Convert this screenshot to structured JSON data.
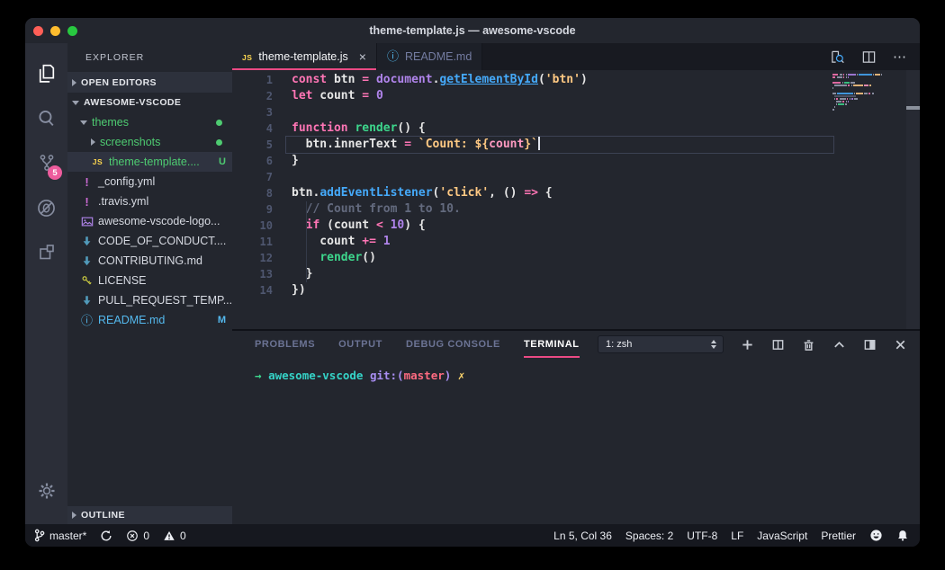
{
  "window": {
    "title": "theme-template.js — awesome-vscode"
  },
  "colors": {
    "traffic_red": "#ff5f57",
    "traffic_yellow": "#febc2e",
    "traffic_green": "#28c840",
    "editor_bg": "#23262e",
    "activitybar_bg": "#2b2e38",
    "tabstrip_bg": "#181a21",
    "statusbar_bg": "#16181f",
    "accent_pink": "#ea4a84",
    "badge_pink": "#ee5c9d",
    "keyword_pink": "#ff75b5",
    "function_blue": "#45a9f9",
    "entity_purple": "#b084eb",
    "string_orange": "#ffc983",
    "function_green": "#3dd68c",
    "comment_gray": "#636a7e",
    "untracked_green": "#4ecb71",
    "modified_blue": "#54b9ee"
  },
  "icons": {
    "close": "×",
    "more": "⋯",
    "info": "ⓘ",
    "exclaim": "!",
    "js_badge": "JS"
  },
  "activity_bar": {
    "scm_badge": "5"
  },
  "sidebar": {
    "title": "EXPLORER",
    "sections": {
      "open_editors": "OPEN EDITORS",
      "workspace": "AWESOME-VSCODE",
      "outline": "OUTLINE"
    },
    "tree": [
      {
        "label": "themes",
        "kind": "folder-open",
        "color": "green",
        "badge": "dot",
        "indent": 1
      },
      {
        "label": "screenshots",
        "kind": "folder-closed",
        "color": "green",
        "badge": "dot",
        "indent": 2
      },
      {
        "label": "theme-template....",
        "icon": "js",
        "color": "green",
        "badge": "U",
        "indent": 2,
        "selected": true
      },
      {
        "label": "_config.yml",
        "icon": "exclaim",
        "indent": 1
      },
      {
        "label": ".travis.yml",
        "icon": "exclaim",
        "indent": 1
      },
      {
        "label": "awesome-vscode-logo...",
        "icon": "image",
        "indent": 1
      },
      {
        "label": "CODE_OF_CONDUCT....",
        "icon": "md",
        "indent": 1
      },
      {
        "label": "CONTRIBUTING.md",
        "icon": "md",
        "indent": 1
      },
      {
        "label": "LICENSE",
        "icon": "key",
        "indent": 1
      },
      {
        "label": "PULL_REQUEST_TEMP...",
        "icon": "md",
        "indent": 1
      },
      {
        "label": "README.md",
        "icon": "info",
        "color": "blue",
        "badge": "M",
        "indent": 1
      }
    ]
  },
  "tabs": [
    {
      "label": "theme-template.js",
      "icon": "js",
      "active": true,
      "closable": true
    },
    {
      "label": "README.md",
      "icon": "info",
      "active": false,
      "closable": false
    }
  ],
  "editor": {
    "active_line": 5,
    "lines": [
      [
        {
          "c": "kw",
          "t": "const"
        },
        {
          "c": "txt",
          "t": " btn "
        },
        {
          "c": "pink",
          "t": "="
        },
        {
          "c": "txt",
          "t": " "
        },
        {
          "c": "purple",
          "t": "document"
        },
        {
          "c": "txt",
          "t": "."
        },
        {
          "c": "blueu",
          "t": "getElementById"
        },
        {
          "c": "txt",
          "t": "("
        },
        {
          "c": "str",
          "t": "'btn'"
        },
        {
          "c": "txt",
          "t": ")"
        }
      ],
      [
        {
          "c": "kw",
          "t": "let"
        },
        {
          "c": "txt",
          "t": " count "
        },
        {
          "c": "pink",
          "t": "="
        },
        {
          "c": "txt",
          "t": " "
        },
        {
          "c": "purple",
          "t": "0"
        }
      ],
      [],
      [
        {
          "c": "kw",
          "t": "function"
        },
        {
          "c": "txt",
          "t": " "
        },
        {
          "c": "green",
          "t": "render"
        },
        {
          "c": "txt",
          "t": "() {"
        }
      ],
      [
        {
          "c": "txt",
          "t": "  btn.innerText "
        },
        {
          "c": "pink",
          "t": "="
        },
        {
          "c": "txt",
          "t": " "
        },
        {
          "c": "str",
          "t": "`Count: ${"
        },
        {
          "c": "pinkl",
          "t": "count"
        },
        {
          "c": "str",
          "t": "}`"
        }
      ],
      [
        {
          "c": "txt",
          "t": "}"
        }
      ],
      [],
      [
        {
          "c": "txt",
          "t": "btn."
        },
        {
          "c": "blue",
          "t": "addEventListener"
        },
        {
          "c": "txt",
          "t": "("
        },
        {
          "c": "str",
          "t": "'click'"
        },
        {
          "c": "txt",
          "t": ", () "
        },
        {
          "c": "pink",
          "t": "=>"
        },
        {
          "c": "txt",
          "t": " {"
        }
      ],
      [
        {
          "c": "com",
          "t": "  // Count from 1 to 10."
        }
      ],
      [
        {
          "c": "txt",
          "t": "  "
        },
        {
          "c": "kw",
          "t": "if"
        },
        {
          "c": "txt",
          "t": " (count "
        },
        {
          "c": "pink",
          "t": "<"
        },
        {
          "c": "txt",
          "t": " "
        },
        {
          "c": "purple",
          "t": "10"
        },
        {
          "c": "txt",
          "t": ") {"
        }
      ],
      [
        {
          "c": "txt",
          "t": "    count "
        },
        {
          "c": "pink",
          "t": "+="
        },
        {
          "c": "txt",
          "t": " "
        },
        {
          "c": "purple",
          "t": "1"
        }
      ],
      [
        {
          "c": "txt",
          "t": "    "
        },
        {
          "c": "green",
          "t": "render"
        },
        {
          "c": "txt",
          "t": "()"
        }
      ],
      [
        {
          "c": "txt",
          "t": "  }"
        }
      ],
      [
        {
          "c": "txt",
          "t": "})"
        }
      ]
    ]
  },
  "panel": {
    "tabs": [
      {
        "label": "PROBLEMS",
        "active": false
      },
      {
        "label": "OUTPUT",
        "active": false
      },
      {
        "label": "DEBUG CONSOLE",
        "active": false
      },
      {
        "label": "TERMINAL",
        "active": true
      }
    ],
    "dropdown_value": "1: zsh",
    "terminal_line": [
      {
        "c": "tm-green",
        "t": "→ "
      },
      {
        "c": "tm-cyan",
        "t": " awesome-vscode "
      },
      {
        "c": "tm-purple",
        "t": "git:("
      },
      {
        "c": "tm-red",
        "t": "master"
      },
      {
        "c": "tm-purple",
        "t": ") "
      },
      {
        "c": "tm-yellow",
        "t": "✗"
      }
    ]
  },
  "status_bar": {
    "branch": "master*",
    "errors": "0",
    "warnings": "0",
    "cursor_position": "Ln 5, Col 36",
    "indentation": "Spaces: 2",
    "encoding": "UTF-8",
    "eol": "LF",
    "language": "JavaScript",
    "formatter": "Prettier"
  }
}
